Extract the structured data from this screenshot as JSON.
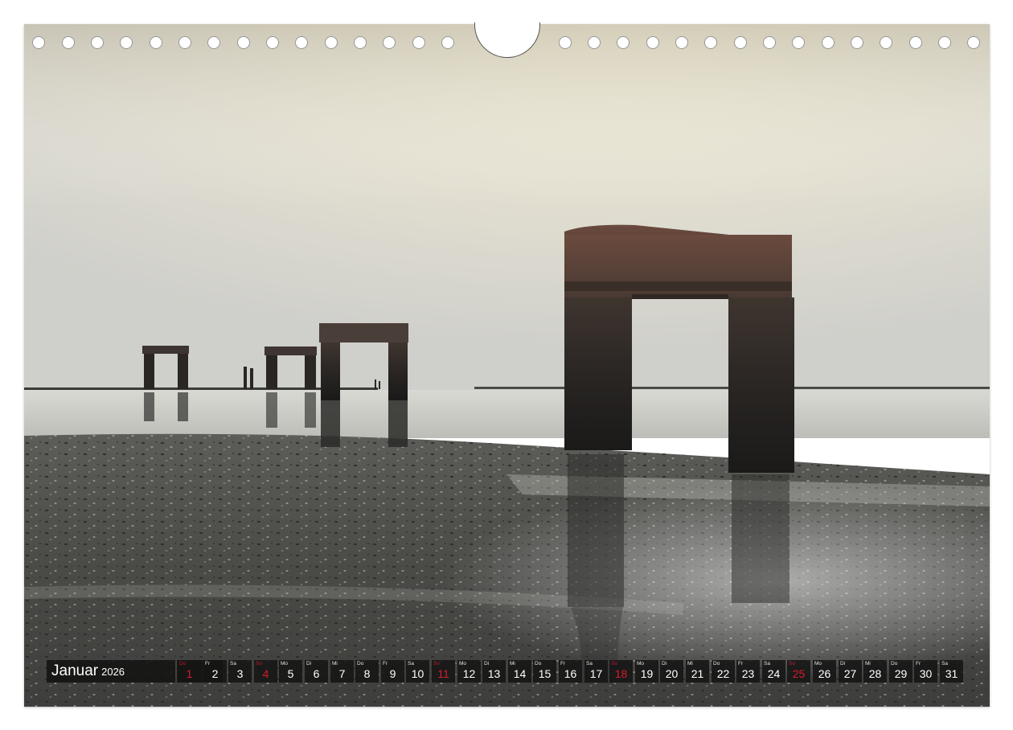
{
  "calendar": {
    "month": "Januar",
    "year": "2026",
    "days": [
      {
        "dow": "Do",
        "day": "1",
        "holiday": true
      },
      {
        "dow": "Fr",
        "day": "2",
        "holiday": false
      },
      {
        "dow": "Sa",
        "day": "3",
        "holiday": false
      },
      {
        "dow": "So",
        "day": "4",
        "holiday": true
      },
      {
        "dow": "Mo",
        "day": "5",
        "holiday": false
      },
      {
        "dow": "Di",
        "day": "6",
        "holiday": false
      },
      {
        "dow": "Mi",
        "day": "7",
        "holiday": false
      },
      {
        "dow": "Do",
        "day": "8",
        "holiday": false
      },
      {
        "dow": "Fr",
        "day": "9",
        "holiday": false
      },
      {
        "dow": "Sa",
        "day": "10",
        "holiday": false
      },
      {
        "dow": "So",
        "day": "11",
        "holiday": true
      },
      {
        "dow": "Mo",
        "day": "12",
        "holiday": false
      },
      {
        "dow": "Di",
        "day": "13",
        "holiday": false
      },
      {
        "dow": "Mi",
        "day": "14",
        "holiday": false
      },
      {
        "dow": "Do",
        "day": "15",
        "holiday": false
      },
      {
        "dow": "Fr",
        "day": "16",
        "holiday": false
      },
      {
        "dow": "Sa",
        "day": "17",
        "holiday": false
      },
      {
        "dow": "So",
        "day": "18",
        "holiday": true
      },
      {
        "dow": "Mo",
        "day": "19",
        "holiday": false
      },
      {
        "dow": "Di",
        "day": "20",
        "holiday": false
      },
      {
        "dow": "Mi",
        "day": "21",
        "holiday": false
      },
      {
        "dow": "Do",
        "day": "22",
        "holiday": false
      },
      {
        "dow": "Fr",
        "day": "23",
        "holiday": false
      },
      {
        "dow": "Sa",
        "day": "24",
        "holiday": false
      },
      {
        "dow": "So",
        "day": "25",
        "holiday": true
      },
      {
        "dow": "Mo",
        "day": "26",
        "holiday": false
      },
      {
        "dow": "Di",
        "day": "27",
        "holiday": false
      },
      {
        "dow": "Mi",
        "day": "28",
        "holiday": false
      },
      {
        "dow": "Do",
        "day": "29",
        "holiday": false
      },
      {
        "dow": "Fr",
        "day": "30",
        "holiday": false
      },
      {
        "dow": "Sa",
        "day": "31",
        "holiday": false
      }
    ]
  },
  "colors": {
    "holiday_red": "#d81b2c",
    "strip_dark": "#141414"
  }
}
